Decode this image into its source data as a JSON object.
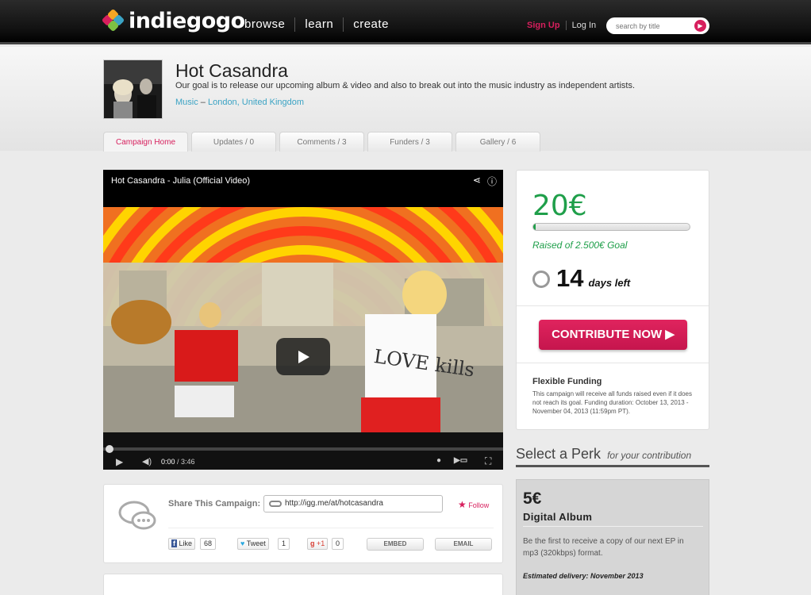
{
  "nav": {
    "logo_text": "indiegogo",
    "links": [
      "browse",
      "learn",
      "create"
    ],
    "signup": "Sign Up",
    "login": "Log In",
    "search_placeholder": "search by title"
  },
  "campaign": {
    "title": "Hot Casandra",
    "tagline": "Our goal is to release our upcoming album & video and also to break out into the music industry as independent artists.",
    "category": "Music",
    "separator": " – ",
    "location": "London, United Kingdom"
  },
  "tabs": [
    "Campaign Home",
    "Updates / 0",
    "Comments / 3",
    "Funders / 3",
    "Gallery / 6"
  ],
  "video": {
    "title": "Hot Casandra - Julia (Official Video)",
    "time_current": "0:00",
    "time_total": " / 3:46",
    "shirt_text": "LOVE kills",
    "progress": 0
  },
  "share": {
    "label": "Share This Campaign:",
    "url": "http://igg.me/at/hotcasandra",
    "follow": "Follow",
    "like_label": "Like",
    "like_count": "68",
    "tweet_label": "Tweet",
    "tweet_count": "1",
    "plusone_label": "+1",
    "plusone_count": "0",
    "embed": "EMBED",
    "email": "EMAIL"
  },
  "stats": {
    "raised": "20€",
    "goal_text": "Raised of 2.500€ Goal",
    "progress_fraction": 0.008,
    "days_num": "14",
    "days_label": "days left",
    "contribute": "CONTRIBUTE NOW ▶",
    "funding_title": "Flexible Funding",
    "funding_text": "This campaign will receive all funds raised even if it does not reach its goal. Funding duration: October 13, 2013 - November 04, 2013 (11:59pm PT)."
  },
  "perk_section": {
    "title": "Select a Perk",
    "subtitle": "for your contribution"
  },
  "perk": {
    "amount": "5€",
    "name": "Digital Album",
    "description": "Be the first to receive a copy of our next EP in mp3 (320kbps) format.",
    "delivery": "Estimated delivery: November 2013"
  },
  "colors": {
    "brand_pink": "#d71f5d",
    "funding_green": "#1f9f4a",
    "link_blue": "#3ba3c4"
  }
}
